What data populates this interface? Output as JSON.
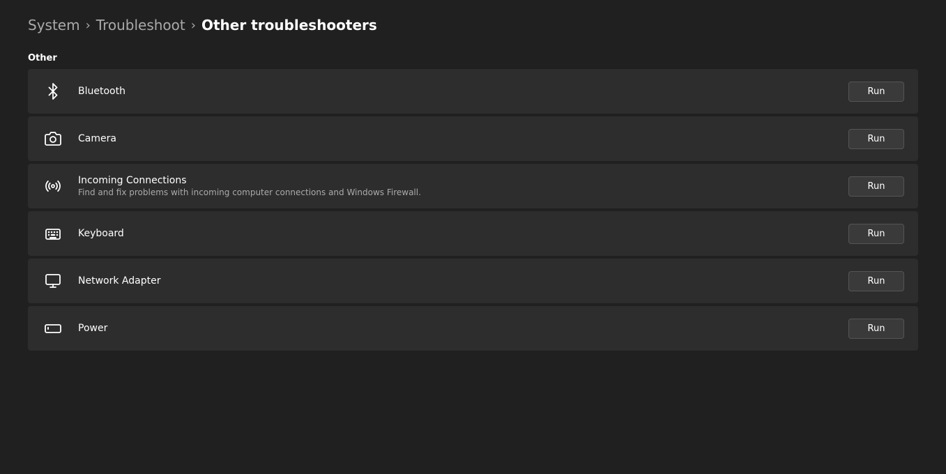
{
  "breadcrumb": {
    "system": "System",
    "troubleshoot": "Troubleshoot",
    "current": "Other troubleshooters"
  },
  "section": {
    "label": "Other"
  },
  "items": [
    {
      "id": "bluetooth",
      "icon": "bluetooth",
      "title": "Bluetooth",
      "description": "",
      "runLabel": "Run"
    },
    {
      "id": "camera",
      "icon": "camera",
      "title": "Camera",
      "description": "",
      "runLabel": "Run"
    },
    {
      "id": "incoming-connections",
      "icon": "incoming-connections",
      "title": "Incoming Connections",
      "description": "Find and fix problems with incoming computer connections and Windows Firewall.",
      "runLabel": "Run"
    },
    {
      "id": "keyboard",
      "icon": "keyboard",
      "title": "Keyboard",
      "description": "",
      "runLabel": "Run"
    },
    {
      "id": "network-adapter",
      "icon": "network-adapter",
      "title": "Network Adapter",
      "description": "",
      "runLabel": "Run"
    },
    {
      "id": "power",
      "icon": "power",
      "title": "Power",
      "description": "",
      "runLabel": "Run"
    }
  ]
}
